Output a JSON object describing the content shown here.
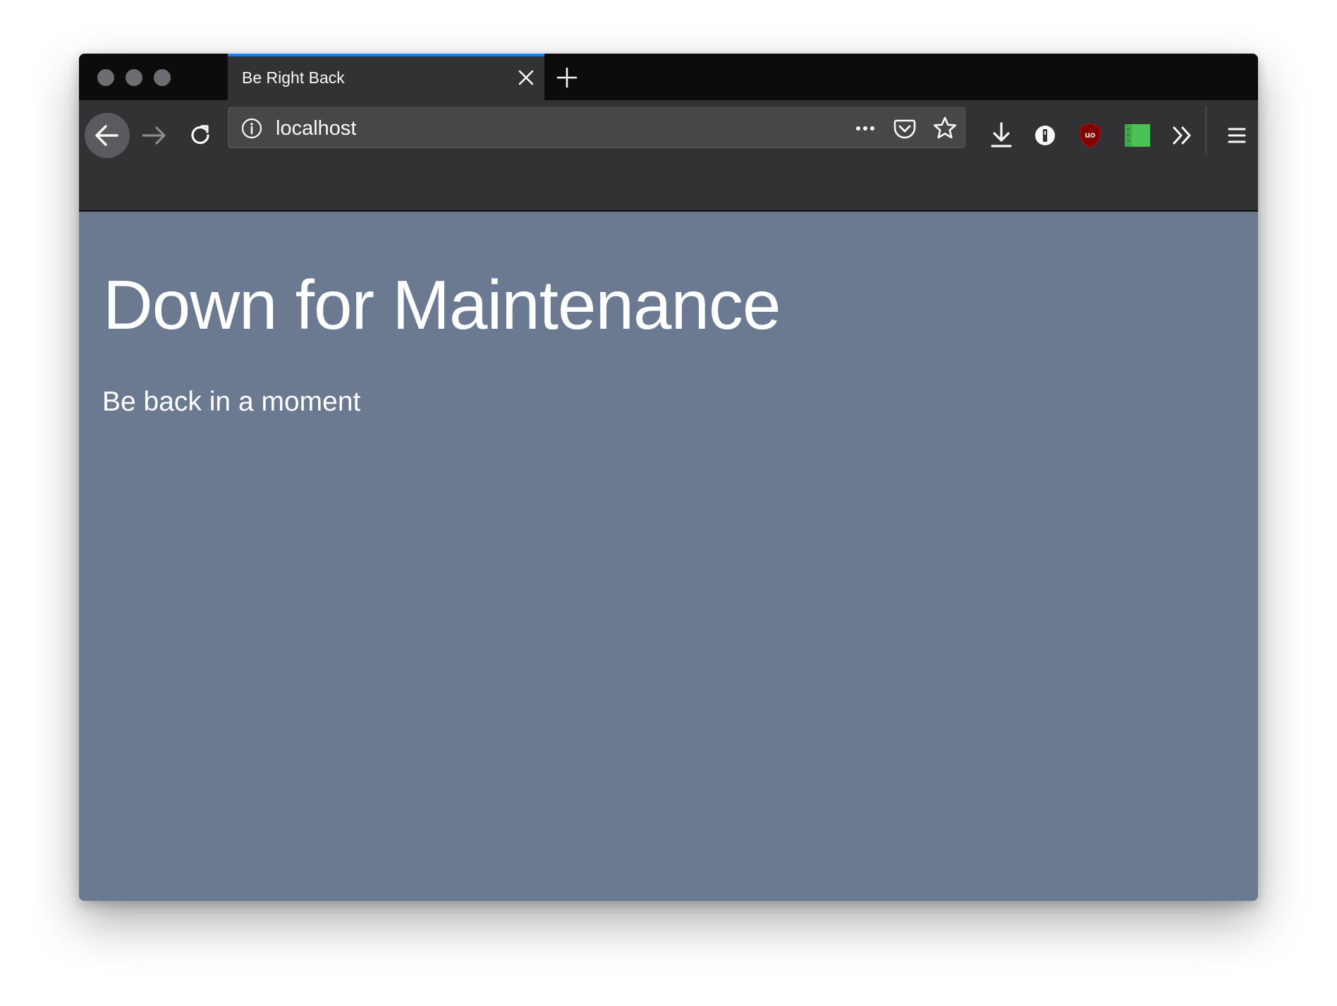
{
  "browser": {
    "tab": {
      "title": "Be Right Back"
    },
    "urlbar": {
      "url": "localhost"
    },
    "accent_color": "#0a84ff",
    "toolbar_icons": [
      "back-arrow-icon",
      "forward-arrow-icon",
      "reload-icon",
      "site-info-icon",
      "page-actions-menu-icon",
      "pocket-icon",
      "bookmark-star-icon",
      "downloads-icon",
      "password-manager-icon",
      "ublock-origin-icon",
      "green-extension-icon",
      "overflow-chevron-icon",
      "hamburger-menu-icon"
    ]
  },
  "page": {
    "background_color": "#6b7a91",
    "heading": "Down for Maintenance",
    "subheading": "Be back in a moment"
  }
}
